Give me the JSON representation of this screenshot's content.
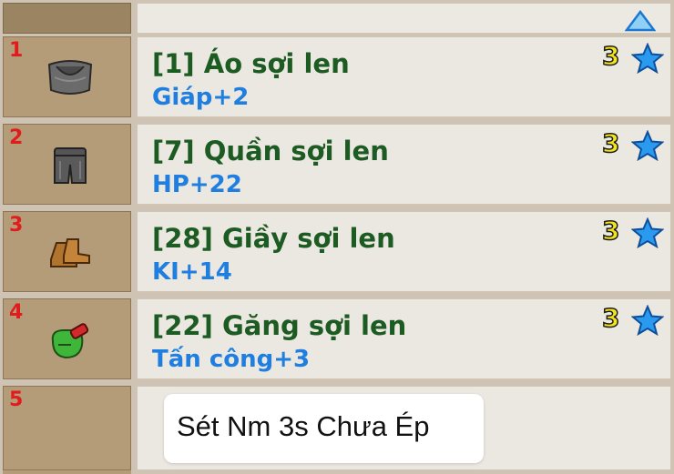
{
  "inventory": {
    "rows": [
      {
        "slot": "1",
        "name": "[1] Áo sợi len",
        "stat": "Giáp+2",
        "stars": "3",
        "icon": "shirt-icon"
      },
      {
        "slot": "2",
        "name": "[7] Quần sợi len",
        "stat": "HP+22",
        "stars": "3",
        "icon": "pants-icon"
      },
      {
        "slot": "3",
        "name": "[28] Giầy sợi len",
        "stat": "KI+14",
        "stars": "3",
        "icon": "boots-icon"
      },
      {
        "slot": "4",
        "name": "[22] Găng sợi len",
        "stat": "Tấn công+3",
        "stars": "3",
        "icon": "gloves-icon"
      }
    ],
    "empty_slot": "5",
    "note": "Sét Nm 3s Chưa Ép"
  },
  "colors": {
    "name": "#1c5b22",
    "stat": "#1f7fe0",
    "slot_number": "#e01c1c",
    "star_count": "#f2e61a",
    "star": "#1f8fe8"
  }
}
